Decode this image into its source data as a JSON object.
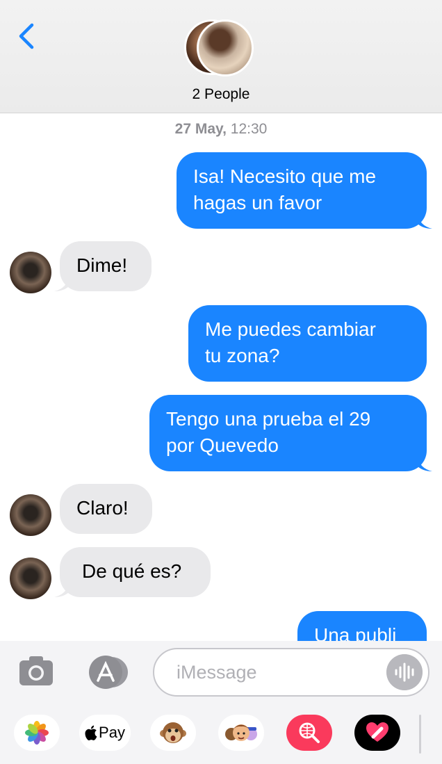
{
  "header": {
    "title": "2 People",
    "back_icon": "chevron-left-icon"
  },
  "timestamp": {
    "date": "27 May,",
    "time": " 12:30"
  },
  "messages": [
    {
      "dir": "out",
      "lines": [
        "Isa! Necesito que me",
        "hagas un favor"
      ]
    },
    {
      "dir": "in",
      "lines": [
        "Dime!"
      ]
    },
    {
      "dir": "out",
      "lines": [
        "Me puedes cambiar",
        "tu zona?"
      ]
    },
    {
      "dir": "out",
      "lines": [
        "Tengo una prueba el 29",
        "por Quevedo"
      ]
    },
    {
      "dir": "in",
      "lines": [
        "Claro!"
      ]
    },
    {
      "dir": "in",
      "lines": [
        "De qué es?"
      ]
    },
    {
      "dir": "out",
      "lines": [
        "Una publi"
      ]
    }
  ],
  "composer": {
    "placeholder": "iMessage",
    "camera_icon": "camera-icon",
    "appstore_icon": "app-store-icon",
    "audio_icon": "waveform-icon"
  },
  "app_drawer": {
    "items": [
      {
        "name": "photos-app-icon"
      },
      {
        "name": "apple-pay-app-icon",
        "label": "Pay"
      },
      {
        "name": "animoji-monkey-icon"
      },
      {
        "name": "memoji-icon"
      },
      {
        "name": "web-search-icon"
      },
      {
        "name": "digital-touch-icon"
      }
    ]
  },
  "colors": {
    "outgoing": "#1a85ff",
    "incoming": "#e9e9eb",
    "accent": "#1a85ff"
  }
}
